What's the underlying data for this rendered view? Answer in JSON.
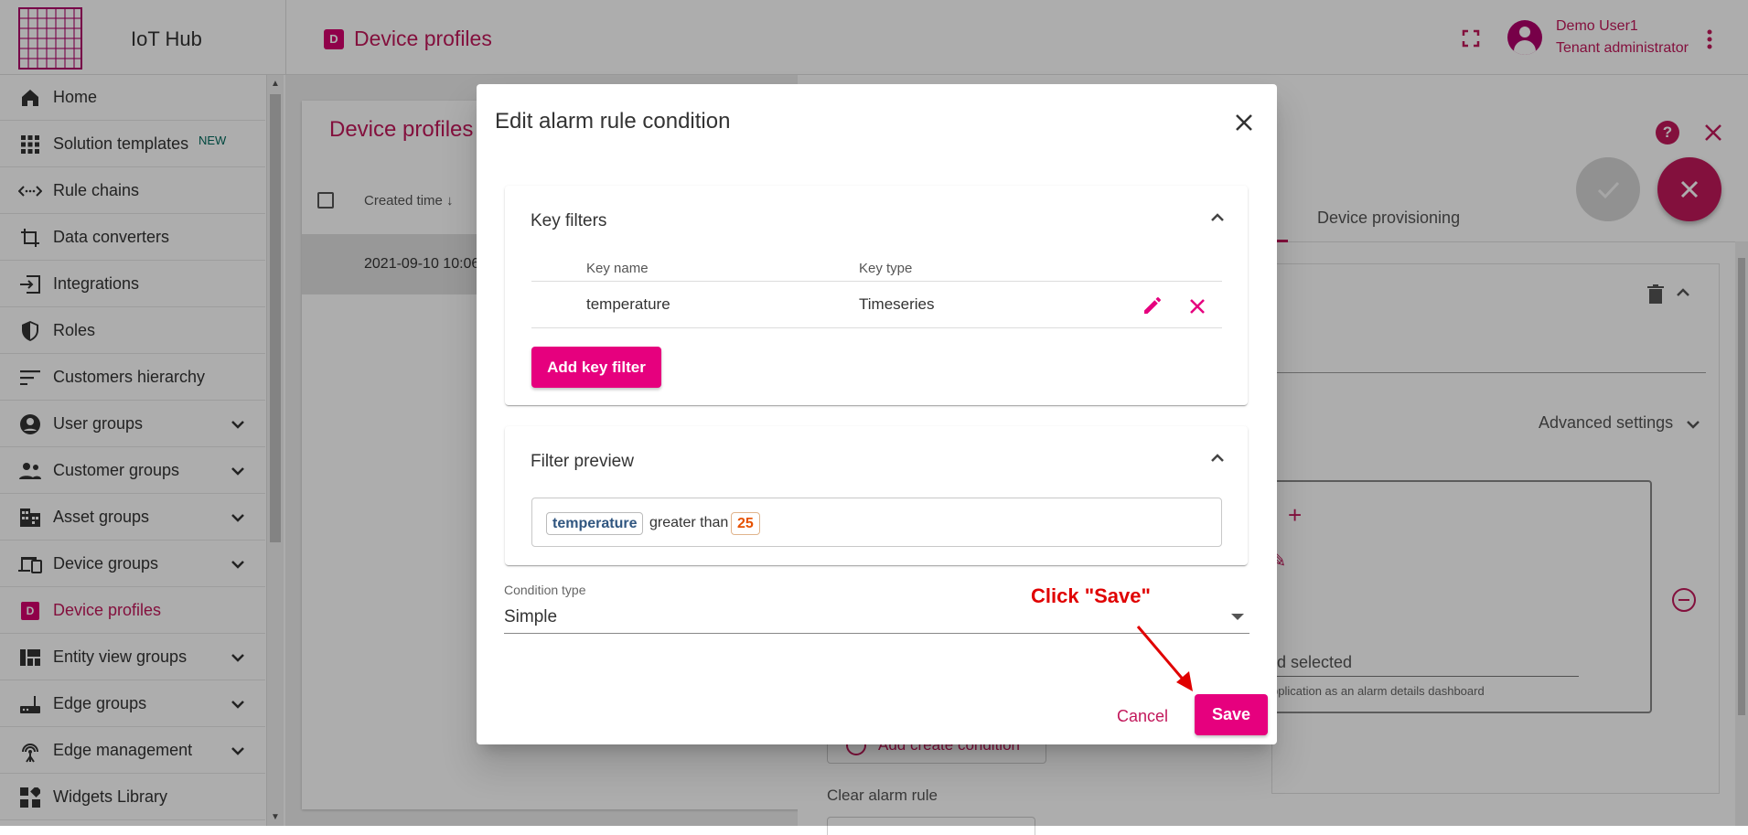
{
  "header": {
    "app_name": "IoT Hub",
    "page_badge": "D",
    "page_title": "Device profiles",
    "user": {
      "name": "Demo User1",
      "role": "Tenant administrator"
    }
  },
  "sidebar": {
    "new_badge": "NEW",
    "items": [
      {
        "label": "Home",
        "icon": "home-icon"
      },
      {
        "label": "Solution templates",
        "icon": "grid-icon"
      },
      {
        "label": "Rule chains",
        "icon": "code-arrows-icon"
      },
      {
        "label": "Data converters",
        "icon": "crop-icon"
      },
      {
        "label": "Integrations",
        "icon": "input-icon"
      },
      {
        "label": "Roles",
        "icon": "shield-icon"
      },
      {
        "label": "Customers hierarchy",
        "icon": "sort-icon"
      },
      {
        "label": "User groups",
        "icon": "account-circle-icon"
      },
      {
        "label": "Customer groups",
        "icon": "supervisor-icon"
      },
      {
        "label": "Asset groups",
        "icon": "domain-icon"
      },
      {
        "label": "Device groups",
        "icon": "devices-icon"
      },
      {
        "label": "Device profiles",
        "icon": "device-profile-icon"
      },
      {
        "label": "Entity view groups",
        "icon": "view-quilt-icon"
      },
      {
        "label": "Edge groups",
        "icon": "router-icon"
      },
      {
        "label": "Edge management",
        "icon": "settings-input-antenna-icon"
      },
      {
        "label": "Widgets Library",
        "icon": "widgets-icon"
      }
    ]
  },
  "background": {
    "list_title": "Device profiles",
    "column_created": "Created time",
    "row_created": "2021-09-10 10:06",
    "tab_provisioning": "Device provisioning",
    "advanced_settings": "Advanced settings",
    "dashboard_partial": "rd selected",
    "dashboard_hint": "pplication as an alarm details dashboard",
    "add_create_condition": "Add create condition",
    "clear_alarm_rule": "Clear alarm rule"
  },
  "dialog": {
    "title": "Edit alarm rule condition",
    "key_filters": {
      "title": "Key filters",
      "col_name": "Key name",
      "col_type": "Key type",
      "rows": [
        {
          "name": "temperature",
          "type": "Timeseries"
        }
      ],
      "add_button": "Add key filter"
    },
    "filter_preview": {
      "title": "Filter preview",
      "key": "temperature",
      "operation": "greater than",
      "value": "25"
    },
    "condition_type": {
      "label": "Condition type",
      "value": "Simple"
    },
    "cancel_label": "Cancel",
    "save_label": "Save"
  },
  "annotation": {
    "text": "Click \"Save\"",
    "color": "#e00000"
  },
  "colors": {
    "accent": "#c2185b",
    "button": "#e6007e"
  }
}
